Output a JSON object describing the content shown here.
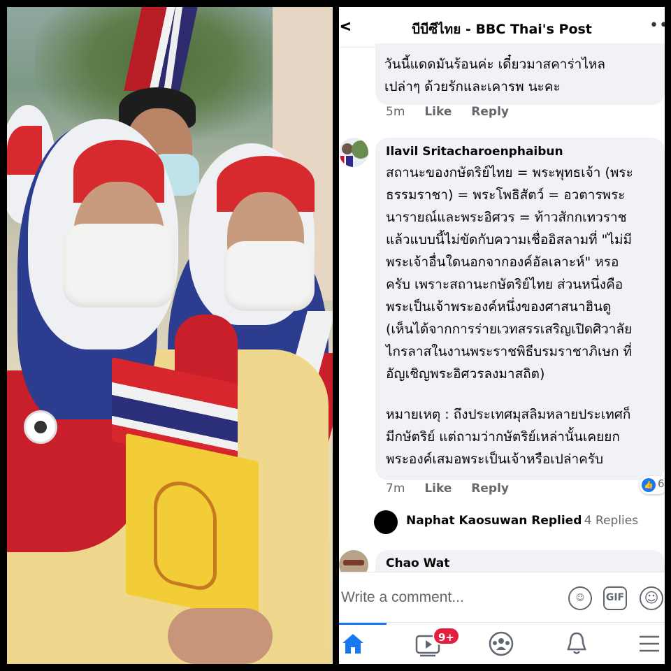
{
  "header": {
    "title": "บีบีซีไทย - BBC Thai's Post"
  },
  "comments": [
    {
      "text_lines": [
        "วันนี้แดดมันร้อนค่ะ เดี๋ยวมาสคาร่าไหล",
        "เปล่าๆ ด้วยรักและเคารพ นะคะ"
      ],
      "time": "5m",
      "like_label": "Like",
      "reply_label": "Reply"
    },
    {
      "author": "Ilavil Sritacharoenphaibun",
      "text_lines": [
        "สถานะของกษัตริย์ไทย = พระพุทธเจ้า (พระ",
        "ธรรมราชา) = พระโพธิสัตว์ = อวตารพระ",
        "นารายณ์และพระอิศวร = ท้าวสักกเทวราช",
        "แล้วแบบนี้ไม่ขัดกับความเชื่ออิสลามที่ \"ไม่มี",
        "พระเจ้าอื่นใดนอกจากองค์อัลเลาะห์\" หรอ",
        "ครับ เพราะสถานะกษัตริย์ไทย ส่วนหนึ่งคือ",
        "พระเป็นเจ้าพระองค์หนึ่งของศาสนาฮินดู",
        "(เห็นได้จากการร่ายเวทสรรเสริญเปิดศิวาลัย",
        "ไกรลาสในงานพระราชพิธีบรมราชาภิเษก ที่",
        "อัญเชิญพระอิศวรลงมาสถิต)",
        "",
        "หมายเหตุ : ถึงประเทศมุสลิมหลายประเทศก็",
        "มีกษัตริย์ แต่ถามว่ากษัตริย์เหล่านั้นเคยยก",
        "พระองค์เสมอพระเป็นเจ้าหรือเปล่าครับ"
      ],
      "time": "7m",
      "like_label": "Like",
      "reply_label": "Reply",
      "reaction_count": "6"
    }
  ],
  "reply_summary": {
    "name": "Naphat Kaosuwan Replied",
    "count": "· 4 Replies"
  },
  "next_comment": {
    "author": "Chao Wat"
  },
  "composer": {
    "placeholder": "Write a comment...",
    "gif_label": "GIF"
  },
  "tabbar": {
    "video_badge": "9+"
  },
  "colors": {
    "facebook_blue": "#1877f2",
    "bubble_gray": "#f0f2f5",
    "badge_red": "#e41e3f"
  },
  "icons": [
    "back-arrow-icon",
    "more-icon",
    "like-icon",
    "sticker-icon",
    "gif-icon",
    "emoji-icon",
    "home-icon",
    "video-icon",
    "groups-icon",
    "bell-icon",
    "menu-icon"
  ]
}
